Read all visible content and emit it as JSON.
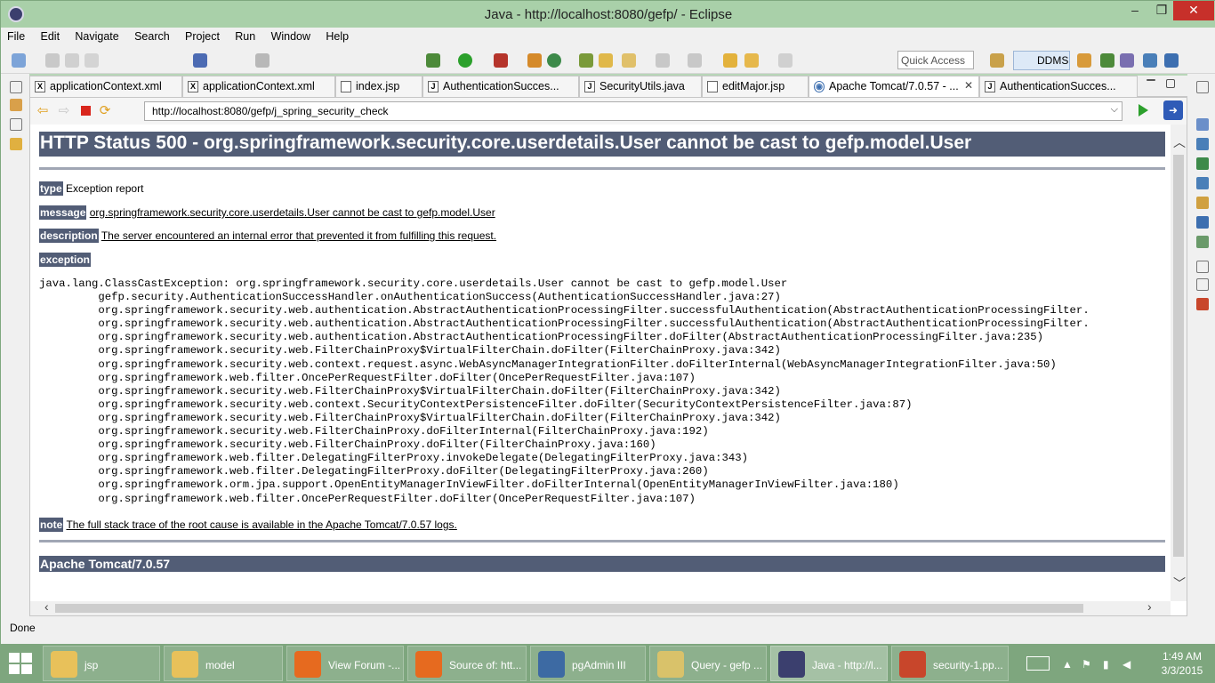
{
  "window": {
    "title": "Java - http://localhost:8080/gefp/ - Eclipse",
    "minimize": "–",
    "maximize": "❐",
    "close": "✕"
  },
  "menu": [
    "File",
    "Edit",
    "Navigate",
    "Search",
    "Project",
    "Run",
    "Window",
    "Help"
  ],
  "toolbar": {
    "quick_access_placeholder": "Quick Access",
    "perspective_label": "DDMS"
  },
  "tabs": [
    {
      "label": "applicationContext.xml",
      "icon": "X"
    },
    {
      "label": "applicationContext.xml",
      "icon": "X"
    },
    {
      "label": "index.jsp",
      "icon": ""
    },
    {
      "label": "AuthenticationSucces...",
      "icon": "J"
    },
    {
      "label": "SecurityUtils.java",
      "icon": "J"
    },
    {
      "label": "editMajor.jsp",
      "icon": ""
    },
    {
      "label": "Apache Tomcat/7.0.57 - ...",
      "icon": "◉"
    },
    {
      "label": "AuthenticationSucces...",
      "icon": "J"
    }
  ],
  "tab_close": "✕",
  "browser": {
    "url": "http://localhost:8080/gefp/j_spring_security_check",
    "url_dropdown": "⌵"
  },
  "page": {
    "heading": "HTTP Status 500 - org.springframework.security.core.userdetails.User cannot be cast to gefp.model.User",
    "type_label": "type",
    "type_value": "Exception report",
    "message_label": "message",
    "message_value": "org.springframework.security.core.userdetails.User cannot be cast to gefp.model.User",
    "description_label": "description",
    "description_value": "The server encountered an internal error that prevented it from fulfilling this request.",
    "exception_label": "exception",
    "stack_trace": [
      "java.lang.ClassCastException: org.springframework.security.core.userdetails.User cannot be cast to gefp.model.User",
      "\tgefp.security.AuthenticationSuccessHandler.onAuthenticationSuccess(AuthenticationSuccessHandler.java:27)",
      "\torg.springframework.security.web.authentication.AbstractAuthenticationProcessingFilter.successfulAuthentication(AbstractAuthenticationProcessingFilter.",
      "\torg.springframework.security.web.authentication.AbstractAuthenticationProcessingFilter.successfulAuthentication(AbstractAuthenticationProcessingFilter.",
      "\torg.springframework.security.web.authentication.AbstractAuthenticationProcessingFilter.doFilter(AbstractAuthenticationProcessingFilter.java:235)",
      "\torg.springframework.security.web.FilterChainProxy$VirtualFilterChain.doFilter(FilterChainProxy.java:342)",
      "\torg.springframework.security.web.context.request.async.WebAsyncManagerIntegrationFilter.doFilterInternal(WebAsyncManagerIntegrationFilter.java:50)",
      "\torg.springframework.web.filter.OncePerRequestFilter.doFilter(OncePerRequestFilter.java:107)",
      "\torg.springframework.security.web.FilterChainProxy$VirtualFilterChain.doFilter(FilterChainProxy.java:342)",
      "\torg.springframework.security.web.context.SecurityContextPersistenceFilter.doFilter(SecurityContextPersistenceFilter.java:87)",
      "\torg.springframework.security.web.FilterChainProxy$VirtualFilterChain.doFilter(FilterChainProxy.java:342)",
      "\torg.springframework.security.web.FilterChainProxy.doFilterInternal(FilterChainProxy.java:192)",
      "\torg.springframework.security.web.FilterChainProxy.doFilter(FilterChainProxy.java:160)",
      "\torg.springframework.web.filter.DelegatingFilterProxy.invokeDelegate(DelegatingFilterProxy.java:343)",
      "\torg.springframework.web.filter.DelegatingFilterProxy.doFilter(DelegatingFilterProxy.java:260)",
      "\torg.springframework.orm.jpa.support.OpenEntityManagerInViewFilter.doFilterInternal(OpenEntityManagerInViewFilter.java:180)",
      "\torg.springframework.web.filter.OncePerRequestFilter.doFilter(OncePerRequestFilter.java:107)"
    ],
    "note_label": "note",
    "note_value": "The full stack trace of the root cause is available in the Apache Tomcat/7.0.57 logs.",
    "footer": "Apache Tomcat/7.0.57"
  },
  "status_text": "Done",
  "taskbar": {
    "items": [
      {
        "label": "jsp",
        "icon": "folder-icon",
        "color": "#e8c15a"
      },
      {
        "label": "model",
        "icon": "folder-icon",
        "color": "#e8c15a"
      },
      {
        "label": "View Forum -...",
        "icon": "firefox-icon",
        "color": "#e66a1f"
      },
      {
        "label": "Source of: htt...",
        "icon": "firefox-icon",
        "color": "#e66a1f"
      },
      {
        "label": "pgAdmin III",
        "icon": "elephant-icon",
        "color": "#3d6aa3"
      },
      {
        "label": "Query - gefp ...",
        "icon": "sql-icon",
        "color": "#d9c26a"
      },
      {
        "label": "Java - http://l...",
        "icon": "javaee-icon",
        "color": "#3b3f6e"
      },
      {
        "label": "security-1.pp...",
        "icon": "powerpoint-icon",
        "color": "#c8462b"
      }
    ],
    "time": "1:49 AM",
    "date": "3/3/2015"
  }
}
